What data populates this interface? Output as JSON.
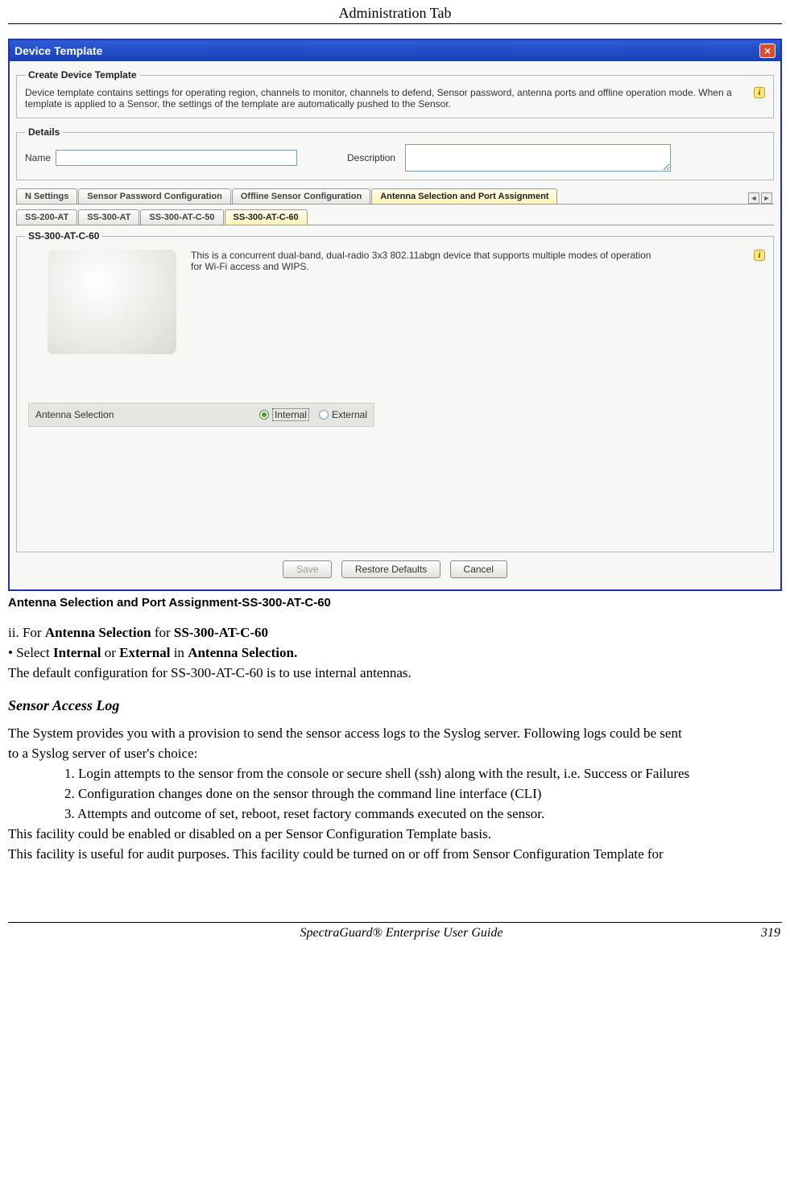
{
  "header": {
    "title": "Administration Tab"
  },
  "dialog": {
    "title": "Device Template",
    "create": {
      "legend": "Create Device Template",
      "desc": "Device template contains settings for operating region, channels to monitor, channels to defend, Sensor password, antenna ports and offline operation mode. When a template is applied to a Sensor, the settings of the template are automatically pushed to the Sensor."
    },
    "details": {
      "legend": "Details",
      "name_label": "Name",
      "desc_label": "Description"
    },
    "tabs1": {
      "items": [
        "N Settings",
        "Sensor Password Configuration",
        "Offline Sensor Configuration",
        "Antenna Selection and Port Assignment"
      ],
      "active": 3
    },
    "tabs2": {
      "items": [
        "SS-200-AT",
        "SS-300-AT",
        "SS-300-AT-C-50",
        "SS-300-AT-C-60"
      ],
      "active": 3
    },
    "content": {
      "legend": "SS-300-AT-C-60",
      "device_text1": "This is a concurrent dual-band, dual-radio 3x3 802.11abgn device that supports multiple modes of operation",
      "device_text2": "for Wi-Fi access and WIPS.",
      "antenna_label": "Antenna Selection",
      "opt_internal": "Internal",
      "opt_external": "External"
    },
    "buttons": {
      "save": "Save",
      "restore": "Restore Defaults",
      "cancel": "Cancel"
    }
  },
  "caption": "Antenna Selection and Port Assignment-SS-300-AT-C-60",
  "doc": {
    "line1_prefix": "ii.        For ",
    "line1_b1": "Antenna Selection",
    "line1_mid": " for ",
    "line1_b2": "SS-300-AT-C-60",
    "bullet_prefix": "•        Select ",
    "bullet_b1": "Internal",
    "bullet_mid": " or ",
    "bullet_b2": "External",
    "bullet_mid2": " in ",
    "bullet_b3": "Antenna Selection.",
    "line3": "The default configuration for SS-300-AT-C-60 is to use internal antennas.",
    "heading": "Sensor Access Log",
    "p1": "The System provides you with a provision to send the sensor access logs to the Syslog server.  Following logs could be sent",
    "p2": "to a Syslog server of user's choice:",
    "ol1": "1. Login attempts to the sensor from the console or secure shell (ssh) along with the result, i.e. Success or Failures",
    "ol2": "2. Configuration changes done on the sensor through the command line interface (CLI)",
    "ol3": "3. Attempts and outcome of set, reboot, reset factory commands executed on the sensor.",
    "p3": "This facility could be enabled or disabled on a per Sensor Configuration Template basis.",
    "p4": "This facility is useful for audit purposes. This facility could be turned on or off from Sensor Configuration Template for"
  },
  "footer": {
    "center": "SpectraGuard® Enterprise User Guide",
    "right": "319"
  }
}
